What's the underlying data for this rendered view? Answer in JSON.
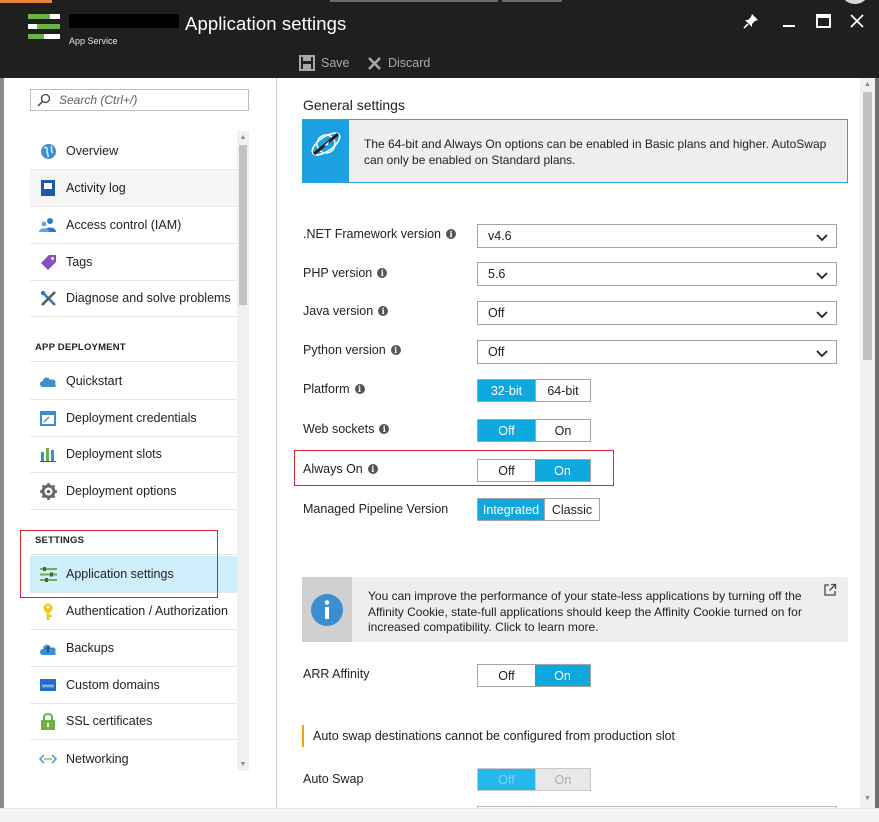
{
  "window": {
    "title": "Application settings",
    "subtitle": "App Service",
    "icons": {
      "pin": "pin-icon",
      "minimize": "minimize-icon",
      "maximize": "maximize-icon",
      "close": "close-icon"
    }
  },
  "toolbar": {
    "save_label": "Save",
    "discard_label": "Discard"
  },
  "sidebar": {
    "search_placeholder": "Search (Ctrl+/)",
    "items": [
      {
        "label": "Overview",
        "icon": "globe-icon"
      },
      {
        "label": "Activity log",
        "icon": "log-icon"
      },
      {
        "label": "Access control (IAM)",
        "icon": "users-icon"
      },
      {
        "label": "Tags",
        "icon": "tag-icon"
      },
      {
        "label": "Diagnose and solve problems",
        "icon": "wrench-icon"
      }
    ],
    "section_deployment": "APP DEPLOYMENT",
    "deployment_items": [
      {
        "label": "Quickstart",
        "icon": "cloud-icon"
      },
      {
        "label": "Deployment credentials",
        "icon": "credentials-icon"
      },
      {
        "label": "Deployment slots",
        "icon": "slots-icon"
      },
      {
        "label": "Deployment options",
        "icon": "gear-icon"
      }
    ],
    "section_settings": "SETTINGS",
    "settings_items": [
      {
        "label": "Application settings",
        "icon": "settings-sliders-icon",
        "active": true
      },
      {
        "label": "Authentication / Authorization",
        "icon": "key-icon"
      },
      {
        "label": "Backups",
        "icon": "backup-cloud-icon"
      },
      {
        "label": "Custom domains",
        "icon": "domain-icon"
      },
      {
        "label": "SSL certificates",
        "icon": "lock-icon"
      },
      {
        "label": "Networking",
        "icon": "network-icon"
      }
    ]
  },
  "main": {
    "section_title": "General settings",
    "plan_notice": "The 64-bit and Always On options can be enabled in Basic plans and higher. AutoSwap can only be enabled on Standard plans.",
    "net_framework": {
      "label": ".NET Framework version",
      "value": "v4.6"
    },
    "php": {
      "label": "PHP version",
      "value": "5.6"
    },
    "java": {
      "label": "Java version",
      "value": "Off"
    },
    "python": {
      "label": "Python version",
      "value": "Off"
    },
    "platform": {
      "label": "Platform",
      "options": [
        "32-bit",
        "64-bit"
      ],
      "selected": "32-bit"
    },
    "web_sockets": {
      "label": "Web sockets",
      "options": [
        "Off",
        "On"
      ],
      "selected": "Off"
    },
    "always_on": {
      "label": "Always On",
      "options": [
        "Off",
        "On"
      ],
      "selected": "On"
    },
    "pipeline": {
      "label": "Managed Pipeline Version",
      "options": [
        "Integrated",
        "Classic"
      ],
      "selected": "Integrated"
    },
    "affinity_notice": "You can improve the performance of your state-less applications by turning off the Affinity Cookie, state-full applications should keep the Affinity Cookie turned on for increased compatibility. Click to learn more.",
    "arr_affinity": {
      "label": "ARR Affinity",
      "options": [
        "Off",
        "On"
      ],
      "selected": "On"
    },
    "autoswap_warning": "Auto swap destinations cannot be configured from production slot",
    "auto_swap": {
      "label": "Auto Swap",
      "options": [
        "Off",
        "On"
      ],
      "selected": "Off"
    }
  },
  "colors": {
    "accent": "#0ea7de",
    "titlebar": "#1f1f1f",
    "highlight_box": "#d7262d",
    "warning": "#f0a30a",
    "active_menu": "#cfeefb"
  }
}
